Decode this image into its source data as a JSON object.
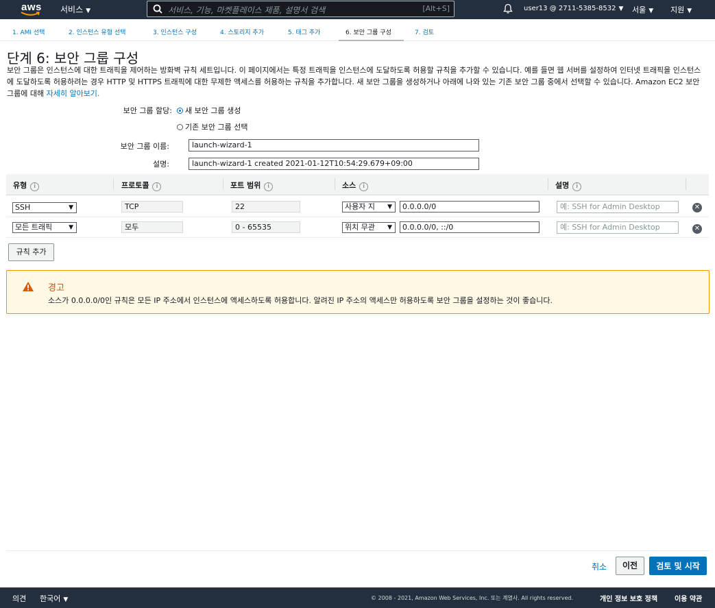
{
  "nav": {
    "logo_text": "aws",
    "services": "서비스",
    "search_placeholder": "서비스, 기능, 마켓플레이스 제품, 설명서 검색",
    "search_shortcut": "[Alt+S]",
    "user": "user13 @ 2711-5385-8532",
    "region": "서울",
    "support": "지원"
  },
  "steps": [
    {
      "label": "1. AMI 선택"
    },
    {
      "label": "2. 인스턴스 유형 선택"
    },
    {
      "label": "3. 인스턴스 구성"
    },
    {
      "label": "4. 스토리지 추가"
    },
    {
      "label": "5. 태그 추가"
    },
    {
      "label": "6. 보안 그룹 구성"
    },
    {
      "label": "7. 검토"
    }
  ],
  "page": {
    "title": "단계 6: 보안 그룹 구성",
    "description": "보안 그룹은 인스턴스에 대한 트래픽을 제어하는 방화벽 규칙 세트입니다. 이 페이지에서는 특정 트래픽을 인스턴스에 도달하도록 허용할 규칙을 추가할 수 있습니다. 예를 들면 웹 서버를 설정하여 인터넷 트래픽을 인스턴스에 도달하도록 허용하려는 경우 HTTP 및 HTTPS 트래픽에 대한 무제한 액세스를 허용하는 규칙을 추가합니다. 새 보안 그룹을 생성하거나 아래에 나와 있는 기존 보안 그룹 중에서 선택할 수 있습니다. Amazon EC2 보안 그룹에 대해 ",
    "learn_more": "자세히 알아보기."
  },
  "form": {
    "assign_label": "보안 그룹 할당:",
    "radio_new": "새 보안 그룹 생성",
    "radio_existing": "기존 보안 그룹 선택",
    "name_label": "보안 그룹 이름:",
    "name_value": "launch-wizard-1",
    "desc_label": "설명:",
    "desc_value": "launch-wizard-1 created 2021-01-12T10:54:29.679+09:00"
  },
  "table": {
    "headers": {
      "type": "유형",
      "protocol": "프로토콜",
      "port": "포트 범위",
      "source": "소스",
      "description": "설명"
    },
    "info_glyph": "i",
    "rows": [
      {
        "type": "SSH",
        "protocol": "TCP",
        "port": "22",
        "source": "사용자 지",
        "cidr": "0.0.0.0/0",
        "desc_placeholder": "예: SSH for Admin Desktop"
      },
      {
        "type": "모든 트래픽",
        "protocol": "모두",
        "port": "0 - 65535",
        "source": "위치 무관",
        "cidr": "0.0.0.0/0, ::/0",
        "desc_placeholder": "예: SSH for Admin Desktop"
      }
    ],
    "add_rule": "규칙 추가"
  },
  "warning": {
    "title": "경고",
    "text": "소스가 0.0.0.0/0인 규칙은 모든 IP 주소에서 인스턴스에 액세스하도록 허용합니다. 알려진 IP 주소의 액세스만 허용하도록 보안 그룹을 설정하는 것이 좋습니다."
  },
  "actions": {
    "cancel": "취소",
    "previous": "이전",
    "review_launch": "검토 및 시작"
  },
  "footer": {
    "feedback": "의견",
    "language": "한국어",
    "copyright": "© 2008 - 2021, Amazon Web Services, Inc. 또는 계열사. All rights reserved.",
    "privacy": "개인 정보 보호 정책",
    "terms": "이용 약관"
  },
  "colors": {
    "nav_bg": "#232f3e",
    "link": "#0073bb",
    "warning_border": "#eb9900",
    "warning_bg": "#fef8e5",
    "primary_button": "#0073bb"
  }
}
